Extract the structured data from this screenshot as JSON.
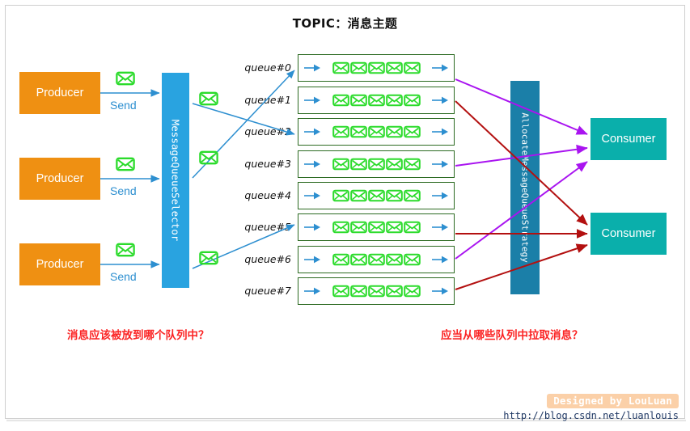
{
  "title": "TOPIC：消息主题",
  "producers": [
    {
      "label": "Producer",
      "send_label": "Send"
    },
    {
      "label": "Producer",
      "send_label": "Send"
    },
    {
      "label": "Producer",
      "send_label": "Send"
    }
  ],
  "selector": {
    "label": "MessageQueueSelector"
  },
  "strategy": {
    "label": "AllocateMessageQueueStrategy"
  },
  "queues": [
    {
      "label": "queue#0",
      "message_count": 5
    },
    {
      "label": "queue#1",
      "message_count": 5
    },
    {
      "label": "queue#2",
      "message_count": 5
    },
    {
      "label": "queue#3",
      "message_count": 5
    },
    {
      "label": "queue#4",
      "message_count": 5
    },
    {
      "label": "queue#5",
      "message_count": 5
    },
    {
      "label": "queue#6",
      "message_count": 5
    },
    {
      "label": "queue#7",
      "message_count": 5
    }
  ],
  "consumers": [
    {
      "label": "Consumer"
    },
    {
      "label": "Consumer"
    }
  ],
  "questions": {
    "left": "消息应该被放到哪个队列中？",
    "right": "应当从哪些队列中拉取消息？"
  },
  "credit": {
    "name": "Designed by LouLuan",
    "url": "http://blog.csdn.net/luanlouis"
  },
  "colors": {
    "producer": "#ef9012",
    "selector": "#29a3e0",
    "strategy": "#1b7fa8",
    "consumer": "#0aafab",
    "queue_border": "#2d6b22",
    "envelope": "#2bdb2b",
    "send_arrow": "#2d8fd0",
    "consumer1_arrow": "#a914f0",
    "consumer2_arrow": "#b31010",
    "question_text": "#fb2424"
  },
  "icons": {
    "message": "envelope-icon"
  }
}
